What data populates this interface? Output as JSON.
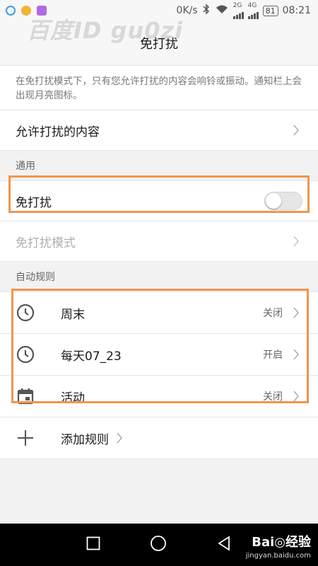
{
  "status_bar": {
    "net_speed": "0K/s",
    "sim1_label": "2G",
    "sim2_label": "4G",
    "battery": "81",
    "time": "08:21"
  },
  "watermark": "百度ID gu0zi",
  "page": {
    "title": "免打扰"
  },
  "description": "在免打扰模式下，只有您允许打扰的内容会响铃或振动。通知栏上会出现月亮图标。",
  "allowed_content": {
    "label": "允许打扰的内容"
  },
  "section_general": "通用",
  "dnd_toggle": {
    "label": "免打扰",
    "enabled": false
  },
  "dnd_mode": {
    "label": "免打扰模式"
  },
  "section_rules": "自动规则",
  "rules": [
    {
      "label": "周末",
      "state": "关闭",
      "icon": "clock-icon"
    },
    {
      "label": "每天07_23",
      "state": "开启",
      "icon": "clock-icon"
    },
    {
      "label": "活动",
      "state": "关闭",
      "icon": "calendar-icon"
    }
  ],
  "add_rule": {
    "label": "添加规则",
    "icon": "plus-icon"
  },
  "brand": {
    "name": "Bai◎经验",
    "url": "jingyan.baidu.com"
  },
  "colors": {
    "highlight": "#f0954a",
    "navbar": "#000000"
  }
}
